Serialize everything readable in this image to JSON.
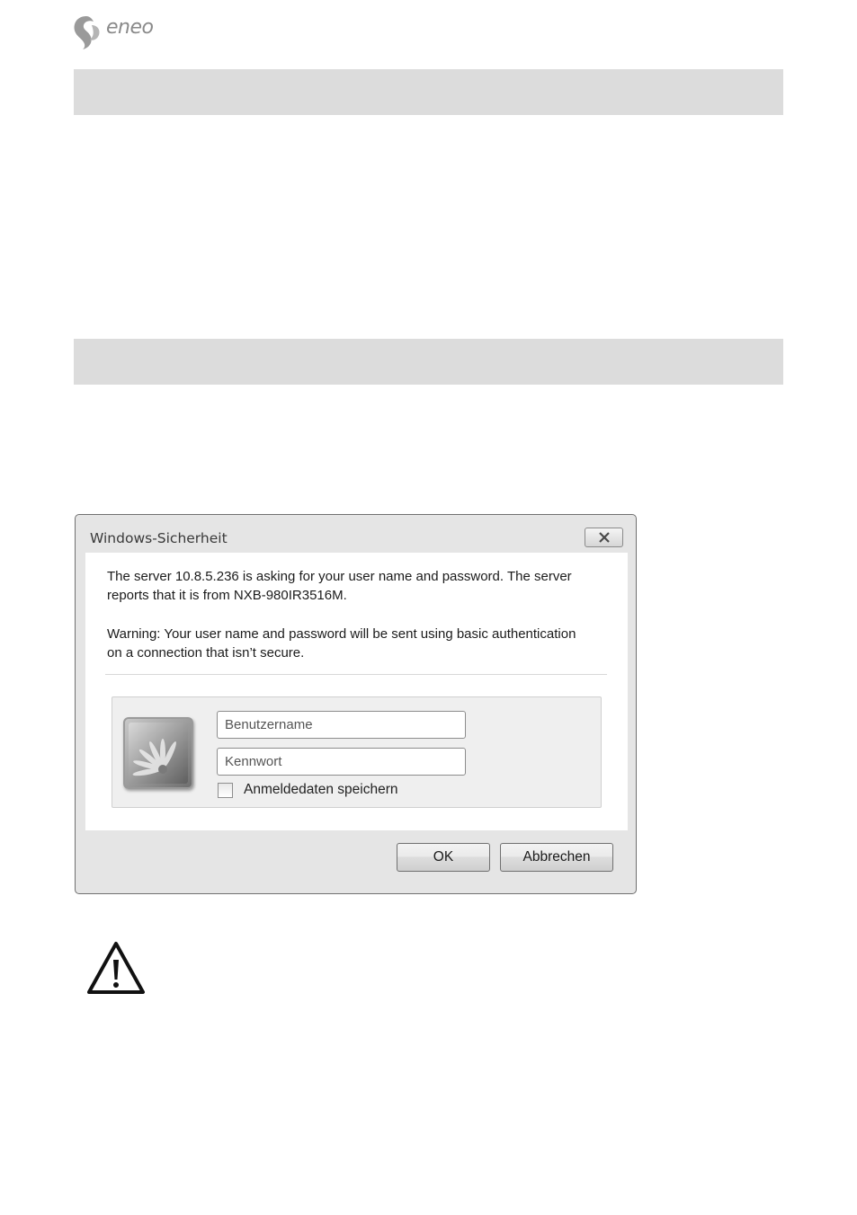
{
  "logo": {
    "text": "eneo"
  },
  "dialog": {
    "title": "Windows-Sicherheit",
    "message_line1": "The server 10.8.5.236 is asking for your user name and password. The server reports that it is from NXB-980IR3516M.",
    "message_line2": "Warning: Your user name and password will be sent using basic authentication on a connection that isn’t secure.",
    "username_placeholder": "Benutzername",
    "password_placeholder": "Kennwort",
    "remember_label": "Anmeldedaten speichern",
    "remember_checked": false,
    "ok_label": "OK",
    "cancel_label": "Abbrechen"
  },
  "icons": {
    "logo": "eneo-logo-icon",
    "close": "close-icon",
    "avatar": "user-avatar-icon",
    "warning": "warning-triangle-icon"
  },
  "colors": {
    "section_bar": "#dcdcdc",
    "dialog_frame": "#e5e5e5"
  }
}
